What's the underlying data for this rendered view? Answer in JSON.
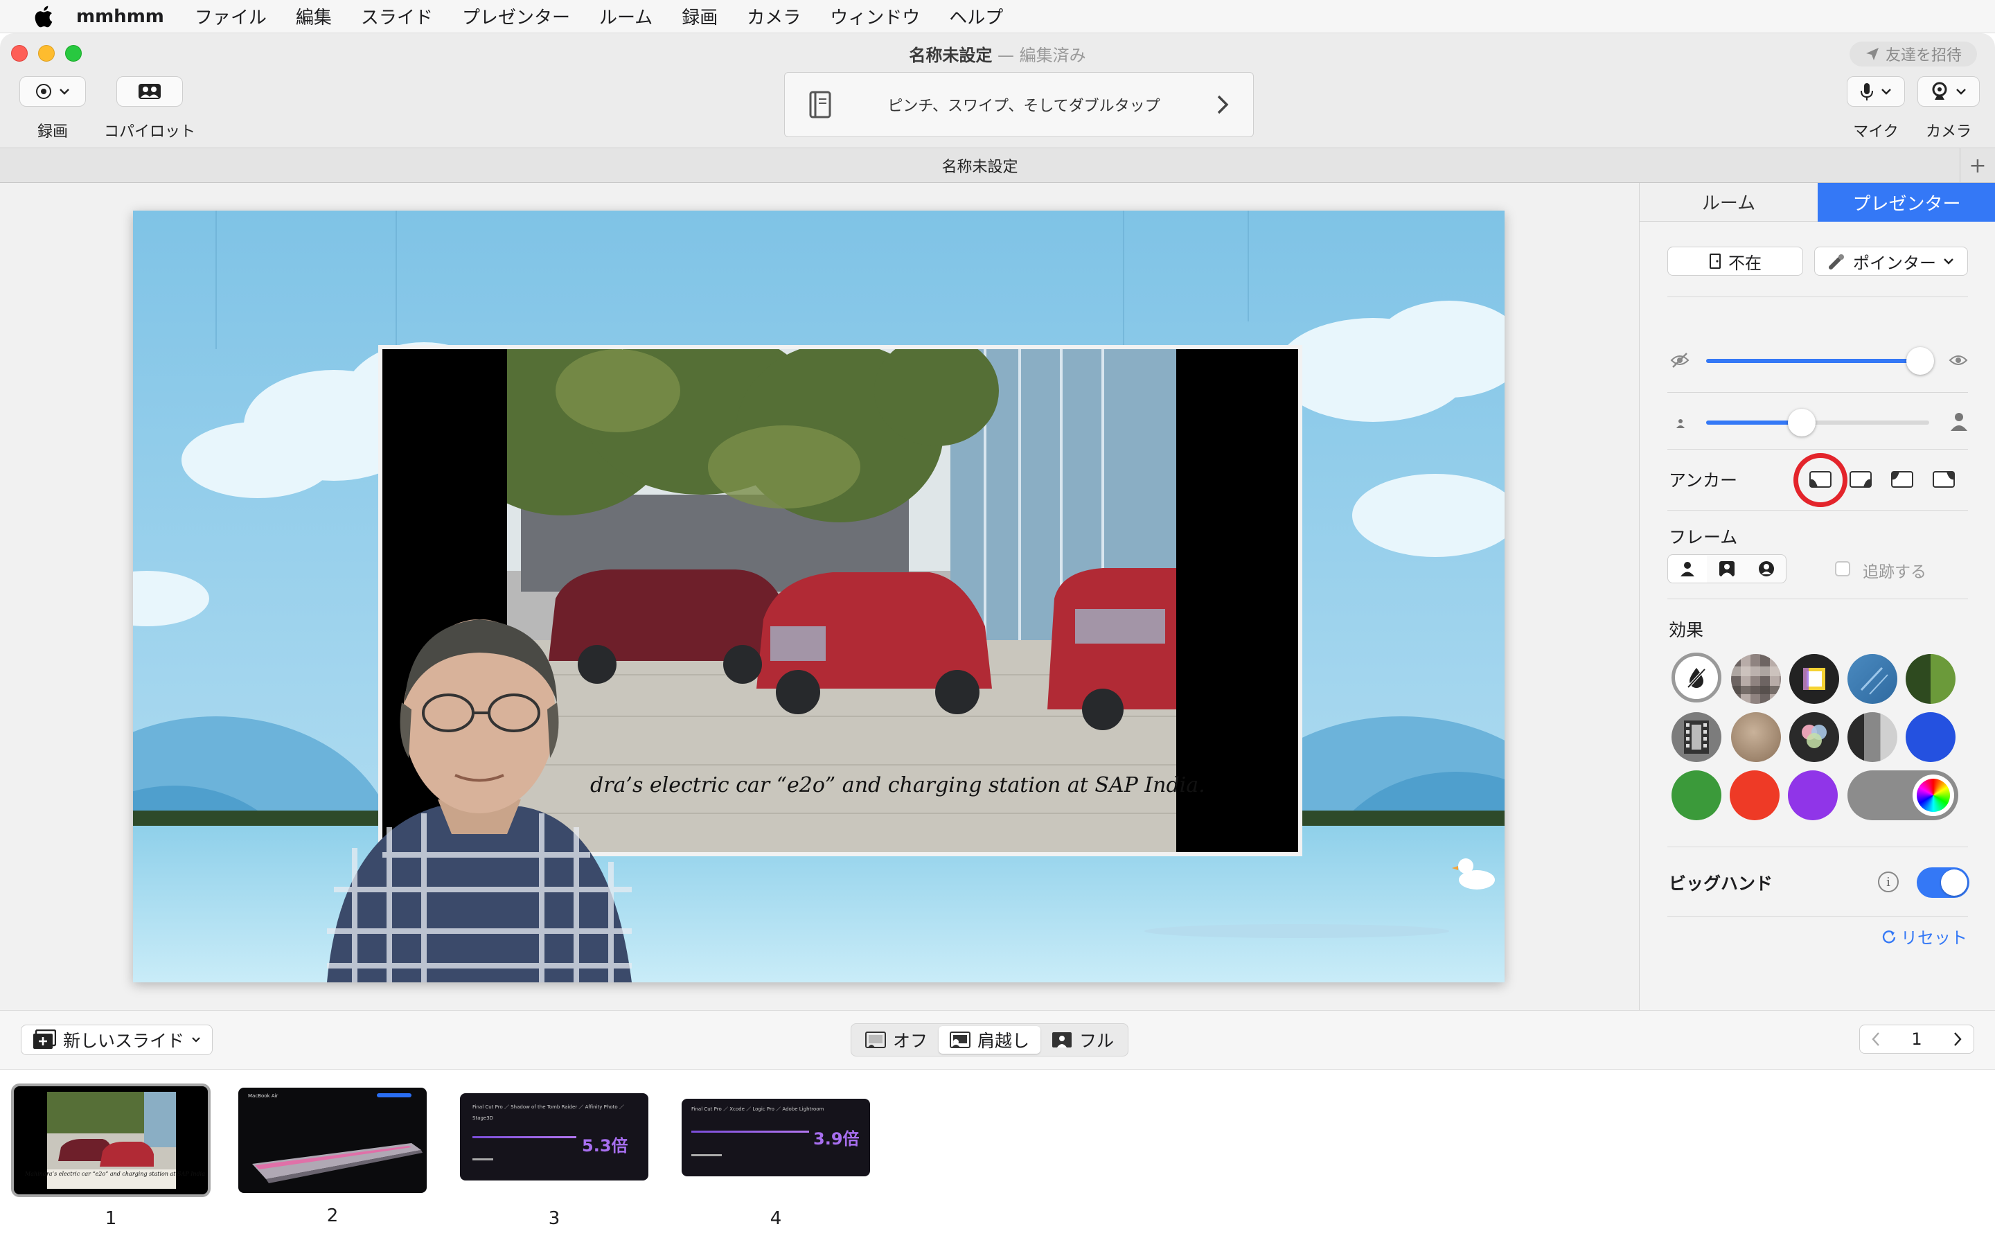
{
  "menubar": {
    "app_name": "mmhmm",
    "items": [
      "ファイル",
      "編集",
      "スライド",
      "プレゼンター",
      "ルーム",
      "録画",
      "カメラ",
      "ウィンドウ",
      "ヘルプ"
    ]
  },
  "window": {
    "title": "名称未設定",
    "title_separator": "—",
    "edited_label": "編集済み",
    "invite_label": "友達を招待"
  },
  "toolbar": {
    "record_label": "録画",
    "copilot_label": "コパイロット",
    "hint_text": "ピンチ、スワイプ、そしてダブルタップ",
    "mic_label": "マイク",
    "camera_label": "カメラ"
  },
  "tab": {
    "label": "名称未設定"
  },
  "stage": {
    "slide_caption": "dra’s electric car “e2o” and  charging station at SAP India."
  },
  "inspector": {
    "tab_room": "ルーム",
    "tab_presenter": "プレゼンター",
    "away_label": "不在",
    "pointer_label": "ポインター",
    "opacity_level": 0.96,
    "size_level": 0.43,
    "anchor_label": "アンカー",
    "frame_label": "フレーム",
    "track_label": "追跡する",
    "effects_label": "効果",
    "bighand_label": "ビッグハンド",
    "bighand_on": true,
    "reset_label": "リセット",
    "accent_color": "#3478f6"
  },
  "bottombar": {
    "new_slide_label": "新しいスライド",
    "view_off": "オフ",
    "view_shoulder": "肩越し",
    "view_full": "フル",
    "page_number": "1"
  },
  "slides": [
    {
      "number": "1",
      "caption": "Mahindra’s electric car “e2o” and charging station at SAP India."
    },
    {
      "number": "2",
      "header": "MacBook Air"
    },
    {
      "number": "3",
      "apps": "Final Cut Pro ／ Shadow of the Tomb Raider ／ Affinity Photo ／ Stage3D",
      "metric": "5.3倍"
    },
    {
      "number": "4",
      "apps": "Final Cut Pro ／ Xcode ／ Logic Pro ／ Adobe Lightroom",
      "metric": "3.9倍"
    }
  ]
}
